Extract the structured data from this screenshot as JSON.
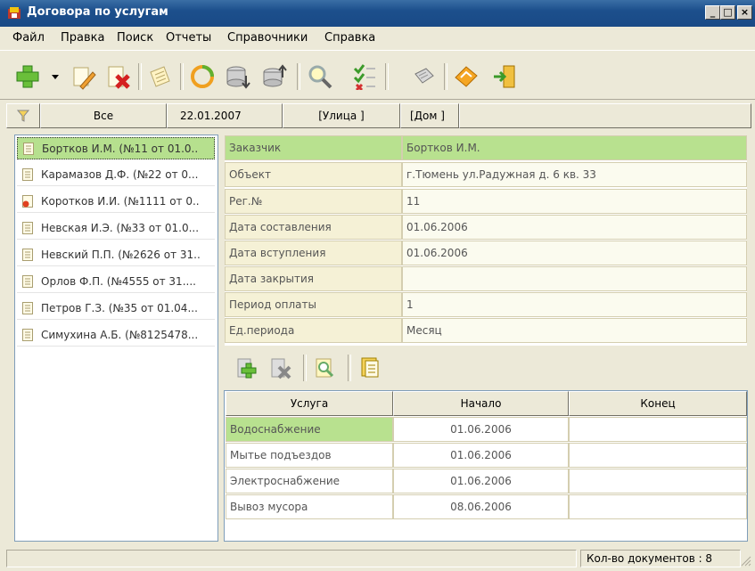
{
  "window": {
    "title": "Договора по услугам",
    "controls": [
      "_",
      "□",
      "×"
    ]
  },
  "menu": [
    "Файл",
    "Правка",
    "Поиск",
    "Отчеты",
    "Справочники",
    "Справка"
  ],
  "toolbar": {
    "icons": [
      "add-icon",
      "dropdown-arrow-icon",
      "edit-icon",
      "delete-icon",
      "document-icon",
      "refresh-icon",
      "database-import-icon",
      "database-export-icon",
      "search-icon",
      "filter-list-icon",
      "print-icon",
      "book-icon",
      "exit-icon"
    ]
  },
  "filter": {
    "all": "Все",
    "date": "22.01.2007",
    "street": "[Улица ]",
    "house": "[Дом ]"
  },
  "contracts": [
    {
      "label": "Бортков И.М. (№11 от 01.0..",
      "icon": "document-icon"
    },
    {
      "label": "Карамазов Д.Ф. (№22 от 0...",
      "icon": "document-icon"
    },
    {
      "label": "Коротков И.И. (№1111 от 0..",
      "icon": "document-closed-icon"
    },
    {
      "label": "Невская И.Э. (№33 от 01.0...",
      "icon": "document-icon"
    },
    {
      "label": "Невский П.П. (№2626 от 31..",
      "icon": "document-icon"
    },
    {
      "label": "Орлов Ф.П. (№4555 от 31....",
      "icon": "document-icon"
    },
    {
      "label": "Петров Г.З. (№35 от 01.04...",
      "icon": "document-icon"
    },
    {
      "label": "Симухина А.Б. (№8125478...",
      "icon": "document-icon"
    }
  ],
  "details": [
    {
      "label": "Заказчик",
      "value": "Бортков И.М."
    },
    {
      "label": "Объект",
      "value": "г.Тюмень ул.Радужная д. 6 кв. 33"
    },
    {
      "label": "Рег.№",
      "value": "11"
    },
    {
      "label": "Дата составления",
      "value": "01.06.2006"
    },
    {
      "label": "Дата вступления",
      "value": "01.06.2006"
    },
    {
      "label": "Дата закрытия",
      "value": ""
    },
    {
      "label": "Период оплаты",
      "value": "1"
    },
    {
      "label": "Ед.периода",
      "value": "Месяц"
    }
  ],
  "services": {
    "headers": [
      "Услуга",
      "Начало",
      "Конец"
    ],
    "rows": [
      [
        "Водоснабжение",
        "01.06.2006",
        ""
      ],
      [
        "Мытье подъездов",
        "01.06.2006",
        ""
      ],
      [
        "Электроснабжение",
        "01.06.2006",
        ""
      ],
      [
        "Вывоз мусора",
        "08.06.2006",
        ""
      ]
    ]
  },
  "status": {
    "count": "Кол-во документов : 8"
  }
}
